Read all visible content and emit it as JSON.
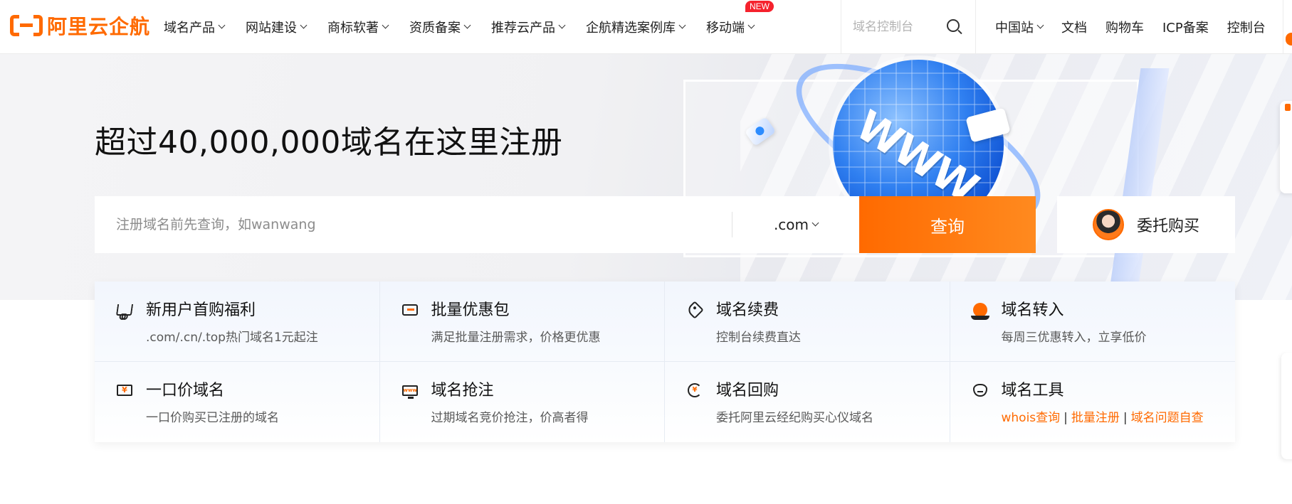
{
  "brand": {
    "name": "阿里云企航",
    "accent": "#ff6a00"
  },
  "nav": {
    "items": [
      {
        "label": "域名产品"
      },
      {
        "label": "网站建设"
      },
      {
        "label": "商标软著"
      },
      {
        "label": "资质备案"
      },
      {
        "label": "推荐云产品"
      },
      {
        "label": "企航精选案例库"
      },
      {
        "label": "移动端",
        "badge": "NEW"
      }
    ]
  },
  "header_search": {
    "placeholder": "域名控制台"
  },
  "right_nav": {
    "region": "中国站",
    "docs": "文档",
    "cart": "购物车",
    "icp": "ICP备案",
    "console": "控制台"
  },
  "hero": {
    "title": "超过40,000,000域名在这里注册",
    "graphic_text": "WWW",
    "search": {
      "placeholder": "注册域名前先查询，如wanwang",
      "tld": ".com",
      "button": "查询"
    },
    "consign": "委托购买"
  },
  "features": [
    {
      "icon": "cart-icon",
      "title": "新用户首购福利",
      "desc": ".com/.cn/.top热门域名1元起注"
    },
    {
      "icon": "ticket-icon",
      "title": "批量优惠包",
      "desc": "满足批量注册需求，价格更优惠"
    },
    {
      "icon": "tag-icon",
      "title": "域名续费",
      "desc": "控制台续费直达"
    },
    {
      "icon": "globe-hand-icon",
      "title": "域名转入",
      "desc": "每周三优惠转入，立享低价"
    },
    {
      "icon": "price-tag-icon",
      "title": "一口价域名",
      "desc": "一口价购买已注册的域名",
      "glyph": "¥"
    },
    {
      "icon": "monitor-icon",
      "title": "域名抢注",
      "desc": "过期域名竞价抢注，价高者得",
      "glyph": "www"
    },
    {
      "icon": "refresh-icon",
      "title": "域名回购",
      "desc": "委托阿里云经纪购买心仪域名",
      "glyph": "¥"
    },
    {
      "icon": "shield-icon",
      "title": "域名工具",
      "links": [
        "whois查询",
        "批量注册",
        "域名问题自查"
      ],
      "separator": "|"
    }
  ]
}
